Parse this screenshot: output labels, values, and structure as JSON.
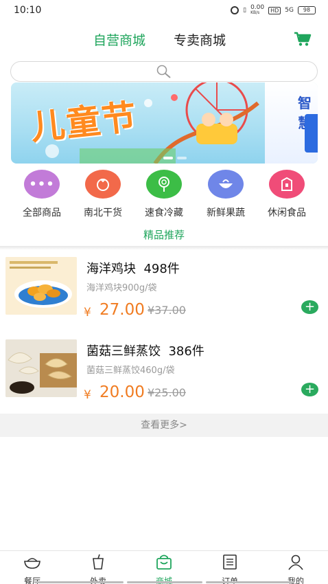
{
  "status_bar": {
    "time": "10:10",
    "net_speed": "0.00",
    "net_unit": "KB/s",
    "hd": "HD",
    "signal": "5G",
    "battery": "98"
  },
  "header": {
    "tabs": [
      {
        "label": "自营商城",
        "active": true
      },
      {
        "label": "专卖商城",
        "active": false
      }
    ],
    "cart_icon": "cart-icon"
  },
  "search": {
    "icon": "search-icon",
    "placeholder": ""
  },
  "banner": {
    "title": "儿童节",
    "right_text": "智慧"
  },
  "categories": [
    {
      "label": "全部商品",
      "color": "#c27bd8",
      "icon": "more-dots-icon"
    },
    {
      "label": "南北干货",
      "color": "#f2694a",
      "icon": "dried-goods-icon"
    },
    {
      "label": "速食冷藏",
      "color": "#3cbd46",
      "icon": "lollipop-icon"
    },
    {
      "label": "新鲜果蔬",
      "color": "#6f86e8",
      "icon": "fruit-icon"
    },
    {
      "label": "休闲食品",
      "color": "#f04c78",
      "icon": "snack-bag-icon"
    }
  ],
  "featured": {
    "title": "精品推荐"
  },
  "products": [
    {
      "name": "海洋鸡块",
      "sold": "498件",
      "desc": "海洋鸡块900g/袋",
      "currency": "¥",
      "price": "27.00",
      "original": "¥37.00"
    },
    {
      "name": "菌菇三鲜蒸饺",
      "sold": "386件",
      "desc": "菌菇三鲜蒸饺460g/袋",
      "currency": "¥",
      "price": "20.00",
      "original": "¥25.00"
    }
  ],
  "more": {
    "label": "查看更多>"
  },
  "bottom_nav": [
    {
      "label": "餐厅",
      "icon": "restaurant-bowl-icon",
      "active": false
    },
    {
      "label": "外卖",
      "icon": "takeout-cup-icon",
      "active": false
    },
    {
      "label": "商城",
      "icon": "shopping-bag-icon",
      "active": true
    },
    {
      "label": "订单",
      "icon": "order-list-icon",
      "active": false
    },
    {
      "label": "我的",
      "icon": "profile-icon",
      "active": false
    }
  ],
  "colors": {
    "accent": "#1fa55c",
    "price": "#f07c22"
  }
}
